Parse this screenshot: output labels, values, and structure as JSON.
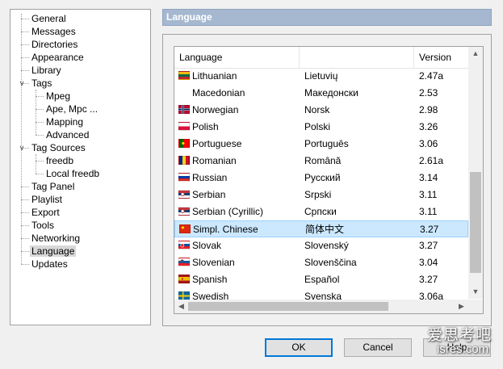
{
  "tree": {
    "items": [
      {
        "label": "General",
        "level": 0,
        "expanded": null,
        "selected": false
      },
      {
        "label": "Messages",
        "level": 0,
        "expanded": null,
        "selected": false
      },
      {
        "label": "Directories",
        "level": 0,
        "expanded": null,
        "selected": false
      },
      {
        "label": "Appearance",
        "level": 0,
        "expanded": null,
        "selected": false
      },
      {
        "label": "Library",
        "level": 0,
        "expanded": null,
        "selected": false
      },
      {
        "label": "Tags",
        "level": 0,
        "expanded": true,
        "selected": false
      },
      {
        "label": "Mpeg",
        "level": 1,
        "expanded": null,
        "selected": false
      },
      {
        "label": "Ape, Mpc ...",
        "level": 1,
        "expanded": null,
        "selected": false
      },
      {
        "label": "Mapping",
        "level": 1,
        "expanded": null,
        "selected": false
      },
      {
        "label": "Advanced",
        "level": 1,
        "expanded": null,
        "selected": false
      },
      {
        "label": "Tag Sources",
        "level": 0,
        "expanded": true,
        "selected": false
      },
      {
        "label": "freedb",
        "level": 1,
        "expanded": null,
        "selected": false
      },
      {
        "label": "Local freedb",
        "level": 1,
        "expanded": null,
        "selected": false
      },
      {
        "label": "Tag Panel",
        "level": 0,
        "expanded": null,
        "selected": false
      },
      {
        "label": "Playlist",
        "level": 0,
        "expanded": null,
        "selected": false
      },
      {
        "label": "Export",
        "level": 0,
        "expanded": null,
        "selected": false
      },
      {
        "label": "Tools",
        "level": 0,
        "expanded": null,
        "selected": false
      },
      {
        "label": "Networking",
        "level": 0,
        "expanded": null,
        "selected": false
      },
      {
        "label": "Language",
        "level": 0,
        "expanded": null,
        "selected": true
      },
      {
        "label": "Updates",
        "level": 0,
        "expanded": null,
        "selected": false
      }
    ]
  },
  "header": {
    "title": "Language"
  },
  "list": {
    "columns": {
      "name": "Language",
      "native": "",
      "version": "Version"
    },
    "rows": [
      {
        "name": "Lithuanian",
        "native": "Lietuvių",
        "version": "2.47a",
        "flag": "lt-flag-icon",
        "selected": false
      },
      {
        "name": "Macedonian",
        "native": "Македонски",
        "version": "2.53",
        "flag": "",
        "selected": false
      },
      {
        "name": "Norwegian",
        "native": "Norsk",
        "version": "2.98",
        "flag": "no-flag-icon",
        "selected": false
      },
      {
        "name": "Polish",
        "native": "Polski",
        "version": "3.26",
        "flag": "pl-flag-icon",
        "selected": false
      },
      {
        "name": "Portuguese",
        "native": "Português",
        "version": "3.06",
        "flag": "pt-flag-icon",
        "selected": false
      },
      {
        "name": "Romanian",
        "native": "Română",
        "version": "2.61a",
        "flag": "ro-flag-icon",
        "selected": false
      },
      {
        "name": "Russian",
        "native": "Русский",
        "version": "3.14",
        "flag": "ru-flag-icon",
        "selected": false
      },
      {
        "name": "Serbian",
        "native": "Srpski",
        "version": "3.11",
        "flag": "rs-flag-icon",
        "selected": false
      },
      {
        "name": "Serbian (Cyrillic)",
        "native": "Српски",
        "version": "3.11",
        "flag": "rs-flag-icon",
        "selected": false
      },
      {
        "name": "Simpl. Chinese",
        "native": "简体中文",
        "version": "3.27",
        "flag": "cn-flag-icon",
        "selected": true
      },
      {
        "name": "Slovak",
        "native": "Slovenský",
        "version": "3.27",
        "flag": "sk-flag-icon",
        "selected": false
      },
      {
        "name": "Slovenian",
        "native": "Slovenščina",
        "version": "3.04",
        "flag": "si-flag-icon",
        "selected": false
      },
      {
        "name": "Spanish",
        "native": "Español",
        "version": "3.27",
        "flag": "es-flag-icon",
        "selected": false
      },
      {
        "name": "Swedish",
        "native": "Svenska",
        "version": "3.06a",
        "flag": "se-flag-icon",
        "selected": false
      }
    ],
    "scroll": {
      "vertical_position": 0.9,
      "vertical_visible": 0.45,
      "horizontal_position": 0.0,
      "horizontal_visible": 0.75
    }
  },
  "buttons": {
    "ok": "OK",
    "cancel": "Cancel",
    "help": "Help"
  },
  "watermark": {
    "line1": "爱思考吧",
    "line2": "isres.com"
  }
}
